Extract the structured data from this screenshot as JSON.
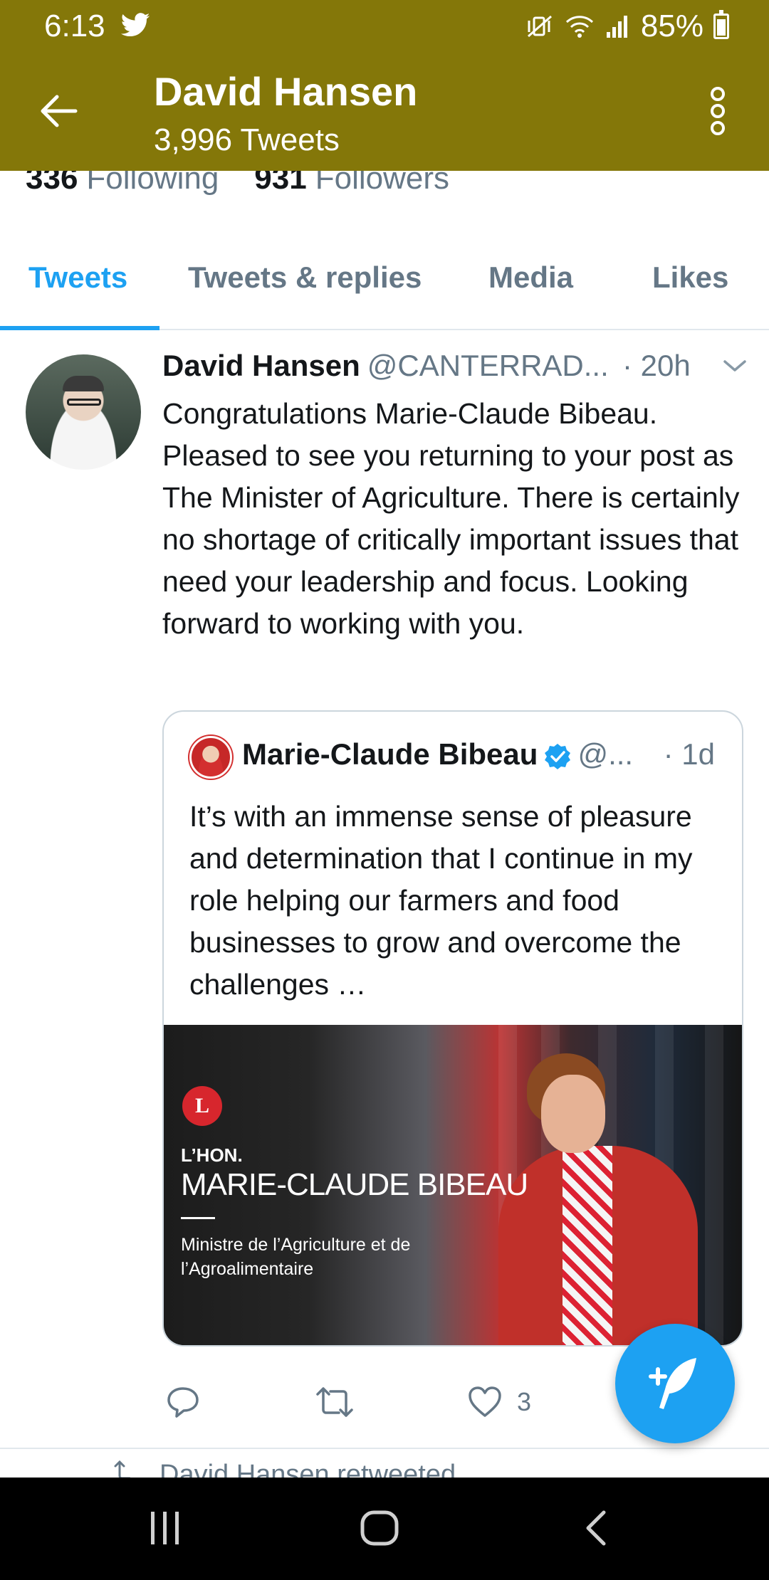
{
  "status_bar": {
    "time": "6:13",
    "battery": "85%",
    "icons": [
      "twitter-icon",
      "mute-vibrate-icon",
      "wifi-icon",
      "signal-icon",
      "battery-icon"
    ]
  },
  "header": {
    "title": "David Hansen",
    "subtitle": "3,996 Tweets"
  },
  "profile_counts": {
    "following_count": "336",
    "following_label": "Following",
    "followers_count": "931",
    "followers_label": "Followers"
  },
  "tabs": [
    {
      "label": "Tweets",
      "active": true
    },
    {
      "label": "Tweets & replies",
      "active": false
    },
    {
      "label": "Media",
      "active": false
    },
    {
      "label": "Likes",
      "active": false
    }
  ],
  "tweet": {
    "author_name": "David Hansen",
    "author_handle": "@CANTERRAD...",
    "time": "· 20h",
    "text": "Congratulations Marie-Claude Bibeau. Pleased to see you returning to your post as The Minister of Agriculture. There is certainly no shortage of critically important issues that need your leadership and focus. Looking forward to working with you.",
    "quoted": {
      "author_name": "Marie-Claude Bibeau",
      "verified": true,
      "author_handle": "@...",
      "time": "· 1d",
      "text": "It’s with an immense sense of pleasure and determination that I continue in my role helping our farmers and food businesses to grow and overcome the challenges …",
      "media": {
        "logo_text": "L",
        "hon": "L’HON.",
        "name": "MARIE-CLAUDE BIBEAU",
        "role": "Ministre de l’Agriculture et de l’Agroalimentaire"
      }
    },
    "like_count": "3"
  },
  "next_item": {
    "retweeted_text": "David Hansen retweeted"
  },
  "colors": {
    "header_bg": "#847709",
    "accent": "#1da1f2",
    "muted": "#657786"
  }
}
